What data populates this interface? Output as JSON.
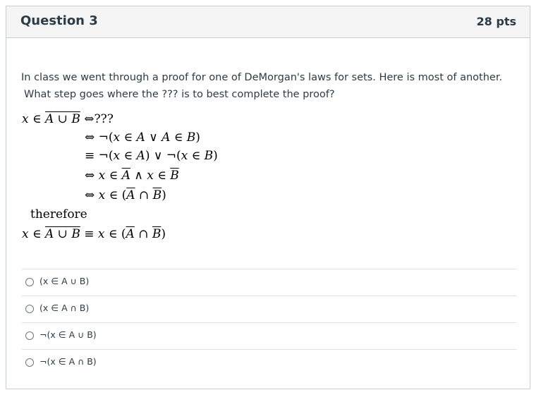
{
  "question": {
    "title": "Question 3",
    "points": "28 pts",
    "prompt_line1": "In class we went through a proof for one of DeMorgan's laws for sets.  Here is most of another.",
    "prompt_line2": "What step goes where the ??? is to best complete the proof?"
  },
  "proof": {
    "line1_lhs": "x ∈ A ∪ B",
    "line1_rhs": "⇔???",
    "line2": "⇔ ¬(x ∈ A ∨ A ∈ B)",
    "line3": "≡ ¬(x ∈ A) ∨ ¬(x ∈ B)",
    "line4": "⇔ x ∈ A ∧ x ∈ B",
    "line5": "⇔ x ∈ (A ∩ B)",
    "therefore": "therefore",
    "conclusion": "x ∈ A ∪ B ≡ x ∈ (A ∩ B)"
  },
  "answers": [
    {
      "label": "(x ∈ A ∪ B)"
    },
    {
      "label": "(x ∈ A ∩ B)"
    },
    {
      "label": "¬(x ∈ A ∪ B)"
    },
    {
      "label": "¬(x ∈ A ∩ B)"
    }
  ]
}
